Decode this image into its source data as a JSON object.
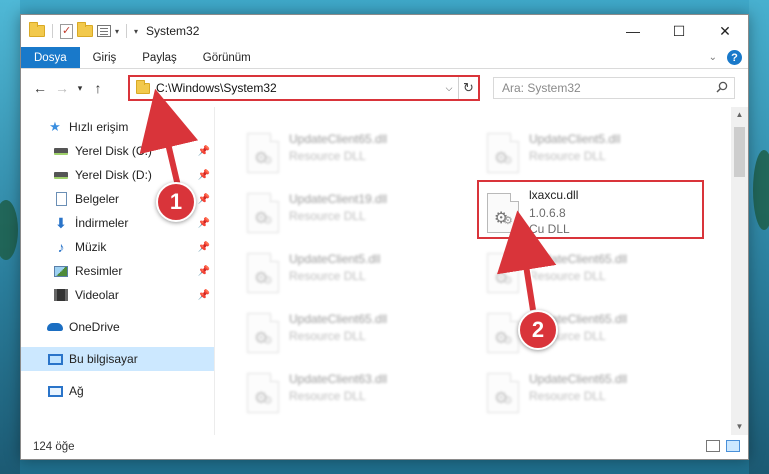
{
  "window": {
    "title": "System32",
    "controls": {
      "minimize": "—",
      "maximize": "☐",
      "close": "✕"
    }
  },
  "ribbon": {
    "tabs": [
      "Dosya",
      "Giriş",
      "Paylaş",
      "Görünüm"
    ]
  },
  "address": {
    "path": "C:\\Windows\\System32",
    "search_placeholder": "Ara: System32"
  },
  "sidebar": {
    "items": [
      {
        "label": "Hızlı erişim",
        "icon": "star-icon"
      },
      {
        "label": "Yerel Disk (C:)",
        "icon": "drive-icon",
        "pinned": true
      },
      {
        "label": "Yerel Disk (D:)",
        "icon": "drive-icon",
        "pinned": true
      },
      {
        "label": "Belgeler",
        "icon": "documents-icon",
        "pinned": true
      },
      {
        "label": "İndirmeler",
        "icon": "downloads-icon",
        "pinned": true
      },
      {
        "label": "Müzik",
        "icon": "music-icon",
        "pinned": true
      },
      {
        "label": "Resimler",
        "icon": "pictures-icon",
        "pinned": true
      },
      {
        "label": "Videolar",
        "icon": "videos-icon",
        "pinned": true
      },
      {
        "label": "OneDrive",
        "icon": "onedrive-icon"
      },
      {
        "label": "Bu bilgisayar",
        "icon": "this-pc-icon",
        "selected": true
      },
      {
        "label": "Ağ",
        "icon": "network-icon"
      }
    ]
  },
  "files": [
    {
      "name": "UpdateClient65.dll",
      "desc": "Resource DLL",
      "blurred": true
    },
    {
      "name": "UpdateClient5.dll",
      "desc": "Resource DLL",
      "blurred": true
    },
    {
      "name": "UpdateClient19.dll",
      "desc": "Resource DLL",
      "blurred": true
    },
    {
      "name": "lxaxcu.dll",
      "version": "1.0.6.8",
      "desc": "Cu DLL",
      "blurred": false
    },
    {
      "name": "UpdateClient5.dll",
      "desc": "Resource DLL",
      "blurred": true
    },
    {
      "name": "UpdateClient65.dll",
      "desc": "Resource DLL",
      "blurred": true
    },
    {
      "name": "UpdateClient65.dll",
      "desc": "Resource DLL",
      "blurred": true
    },
    {
      "name": "UpdateClient65.dll",
      "desc": "Resource DLL",
      "blurred": true
    },
    {
      "name": "UpdateClient63.dll",
      "desc": "Resource DLL",
      "blurred": true
    },
    {
      "name": "UpdateClient65.dll",
      "desc": "Resource DLL",
      "blurred": true
    }
  ],
  "status": {
    "count": "124 öğe"
  },
  "annotations": {
    "step1": "1",
    "step2": "2"
  },
  "colors": {
    "accent": "#1979ca",
    "highlight": "#d9343a"
  }
}
